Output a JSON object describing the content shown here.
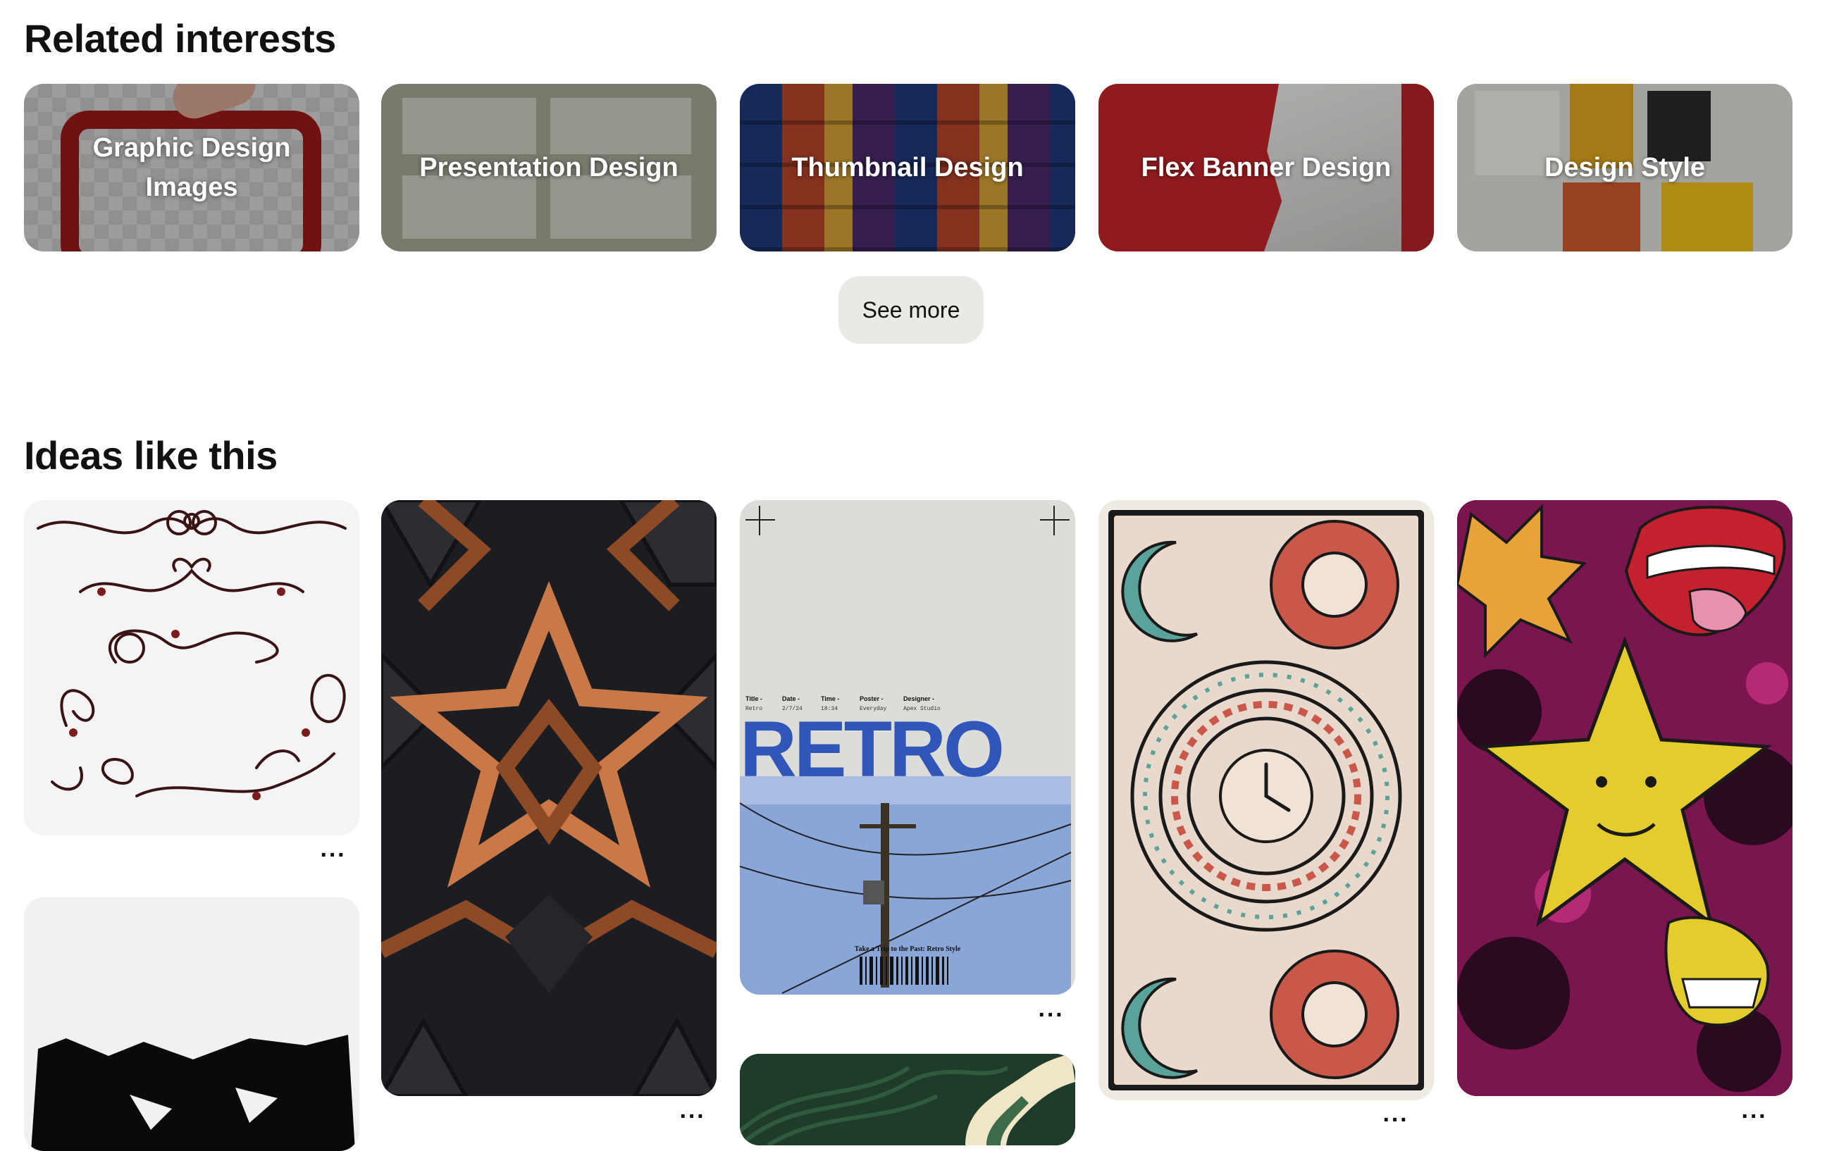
{
  "related": {
    "title": "Related interests",
    "items": [
      {
        "label": "Graphic Design Images"
      },
      {
        "label": "Presentation Design"
      },
      {
        "label": "Thumbnail Design"
      },
      {
        "label": "Flex Banner Design"
      },
      {
        "label": "Design Style"
      }
    ],
    "see_more": "See more"
  },
  "ideas": {
    "title": "Ideas like this",
    "more_icon": "ellipsis-icon",
    "retro_poster": {
      "fields": [
        "Title -",
        "Date -",
        "Time -",
        "Poster -",
        "Designer -"
      ],
      "values": [
        "Retro",
        "2/7/24",
        "18:34",
        "Everyday",
        "Apex Studio"
      ],
      "headline": "RETRO",
      "tagline": "Take a Trip to the Past: Retro Style"
    }
  },
  "colors": {
    "button_bg": "#e9e9e6",
    "copper": "#c97846",
    "dark_hex": "#2a2d33",
    "retro_blue": "#2f56b8",
    "magenta": "#8e1d5c",
    "star_yellow": "#e3cc2c"
  }
}
